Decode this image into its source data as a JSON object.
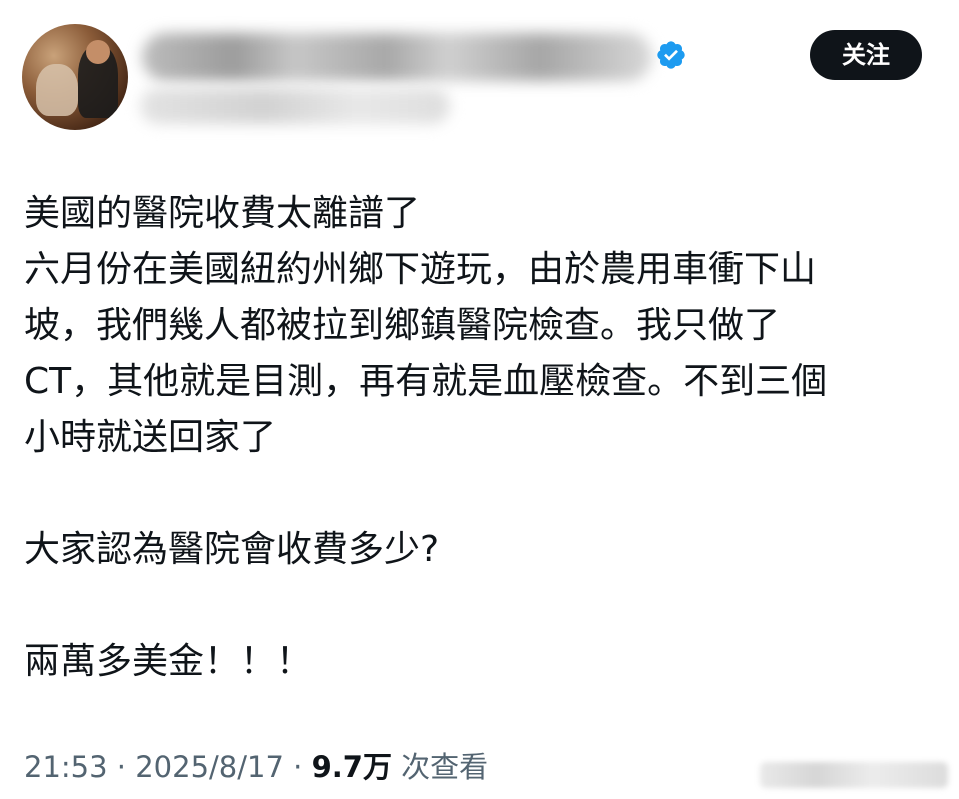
{
  "header": {
    "follow_label": "关注",
    "verified_color": "#1d9bf0",
    "avatar_icon": "user-avatar-photo"
  },
  "post": {
    "lines": [
      "美國的醫院收費太離譜了",
      "六月份在美國紐約州鄉下遊玩，由於農用車衝下山",
      "坡，我們幾人都被拉到鄉鎮醫院檢查。我只做了",
      "CT，其他就是目測，再有就是血壓檢查。不到三個",
      "小時就送回家了",
      "",
      "大家認為醫院會收費多少?",
      "",
      "兩萬多美金！！！"
    ]
  },
  "meta": {
    "time": "21:53",
    "separator1": " · ",
    "date": "2025/8/17",
    "separator2": " · ",
    "views_count": "9.7万",
    "views_label": " 次查看"
  },
  "colors": {
    "text": "#0f1419",
    "secondary": "#536471",
    "button_bg": "#0f1419"
  }
}
